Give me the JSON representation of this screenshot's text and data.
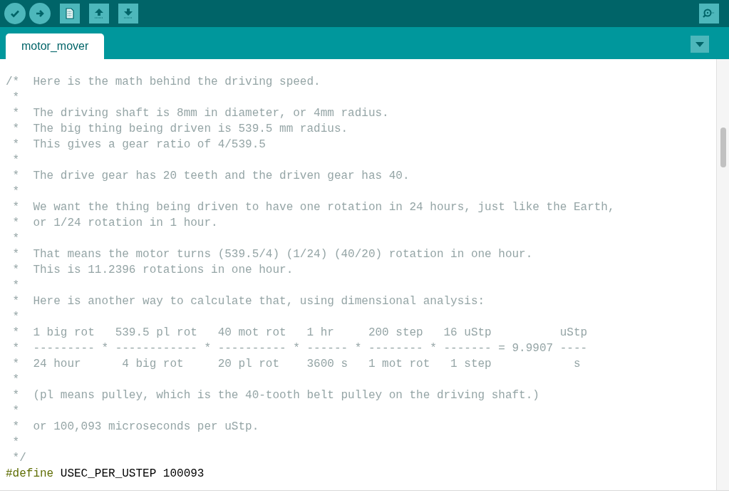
{
  "toolbar": [
    {
      "kind": "verify"
    },
    {
      "kind": "upload"
    },
    {
      "kind": "new"
    },
    {
      "kind": "open"
    },
    {
      "kind": "save"
    }
  ],
  "serial_monitor": {
    "kind": "serial"
  },
  "tabs": [
    {
      "label": "motor_mover",
      "selected": true
    }
  ],
  "code": [
    {
      "kind": "comment",
      "text": "/*  Here is the math behind the driving speed."
    },
    {
      "kind": "comment",
      "text": " *"
    },
    {
      "kind": "comment",
      "text": " *  The driving shaft is 8mm in diameter, or 4mm radius."
    },
    {
      "kind": "comment",
      "text": " *  The big thing being driven is 539.5 mm radius."
    },
    {
      "kind": "comment",
      "text": " *  This gives a gear ratio of 4/539.5"
    },
    {
      "kind": "comment",
      "text": " *"
    },
    {
      "kind": "comment",
      "text": " *  The drive gear has 20 teeth and the driven gear has 40."
    },
    {
      "kind": "comment",
      "text": " *"
    },
    {
      "kind": "comment",
      "text": " *  We want the thing being driven to have one rotation in 24 hours, just like the Earth,"
    },
    {
      "kind": "comment",
      "text": " *  or 1/24 rotation in 1 hour."
    },
    {
      "kind": "comment",
      "text": " *"
    },
    {
      "kind": "comment",
      "text": " *  That means the motor turns (539.5/4) (1/24) (40/20) rotation in one hour."
    },
    {
      "kind": "comment",
      "text": " *  This is 11.2396 rotations in one hour."
    },
    {
      "kind": "comment",
      "text": " *"
    },
    {
      "kind": "comment",
      "text": " *  Here is another way to calculate that, using dimensional analysis:"
    },
    {
      "kind": "comment",
      "text": " *"
    },
    {
      "kind": "comment",
      "text": " *  1 big rot   539.5 pl rot   40 mot rot   1 hr     200 step   16 uStp          uStp"
    },
    {
      "kind": "comment",
      "text": " *  --------- * ------------ * ---------- * ------ * -------- * ------- = 9.9907 ----"
    },
    {
      "kind": "comment",
      "text": " *  24 hour      4 big rot     20 pl rot    3600 s   1 mot rot   1 step            s"
    },
    {
      "kind": "comment",
      "text": " *"
    },
    {
      "kind": "comment",
      "text": " *  (pl means pulley, which is the 40-tooth belt pulley on the driving shaft.)"
    },
    {
      "kind": "comment",
      "text": " *"
    },
    {
      "kind": "comment",
      "text": " *  or 100,093 microseconds per uStp."
    },
    {
      "kind": "comment",
      "text": " *"
    },
    {
      "kind": "comment",
      "text": " */"
    },
    {
      "kind": "define",
      "keyword": "#define",
      "text": "USEC_PER_USTEP 100093"
    }
  ]
}
